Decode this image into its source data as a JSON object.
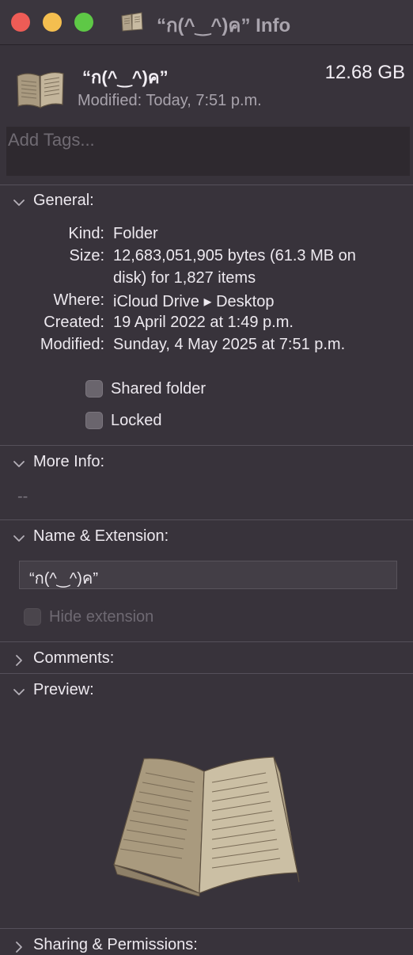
{
  "window": {
    "title": "“ก(^‿^)ค” Info",
    "traffic_lights": {
      "close_color": "#ee5c56",
      "minimize_color": "#f4be4f",
      "zoom_color": "#5ec846"
    }
  },
  "header": {
    "icon": "open-book-icon",
    "name": "“ก(^‿^)ค”",
    "size": "12.68 GB",
    "modified": "Modified: Today, 7:51 p.m.",
    "tags_placeholder": "Add Tags..."
  },
  "general": {
    "title": "General:",
    "expanded": true,
    "rows": [
      {
        "label": "Kind:",
        "value": "Folder"
      },
      {
        "label": "Size:",
        "value": "12,683,051,905 bytes (61.3 MB on",
        "value2": "disk) for 1,827 items"
      },
      {
        "label": "Where:",
        "value": "iCloud Drive ▸ Desktop"
      },
      {
        "label": "Created:",
        "value": "19 April 2022 at 1:49 p.m."
      },
      {
        "label": "Modified:",
        "value": "Sunday, 4 May 2025 at 7:51 p.m."
      }
    ],
    "shared_folder_label": "Shared folder",
    "locked_label": "Locked"
  },
  "more_info": {
    "title": "More Info:",
    "expanded": true,
    "value": "--"
  },
  "name_extension": {
    "title": "Name & Extension:",
    "expanded": true,
    "name_value": "“ก(^‿^)ค”",
    "hide_extension_label": "Hide extension"
  },
  "comments": {
    "title": "Comments:",
    "expanded": false
  },
  "preview": {
    "title": "Preview:",
    "expanded": true,
    "image": "open-book-preview"
  },
  "sharing": {
    "title": "Sharing & Permissions:",
    "expanded": false
  }
}
